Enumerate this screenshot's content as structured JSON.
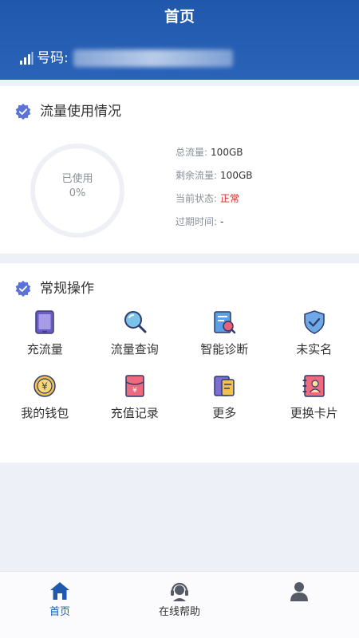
{
  "header": {
    "title": "首页",
    "phone_label": "号码:",
    "signal_icon": "signal-icon"
  },
  "usage": {
    "title": "流量使用情况",
    "ring_label": "已使用",
    "ring_percent": "0%",
    "used_fraction": 0,
    "stats": [
      {
        "key": "总流量:",
        "value": "100GB"
      },
      {
        "key": "剩余流量:",
        "value": "100GB"
      },
      {
        "key": "当前状态:",
        "value": "正常"
      },
      {
        "key": "过期时间:",
        "value": "-"
      }
    ]
  },
  "operations": {
    "title": "常规操作",
    "items": [
      {
        "label": "充流量",
        "icon": "tablet-icon"
      },
      {
        "label": "流量查询",
        "icon": "magnifier-icon"
      },
      {
        "label": "智能诊断",
        "icon": "diagnosis-icon"
      },
      {
        "label": "未实名",
        "icon": "shield-check-icon"
      },
      {
        "label": "我的钱包",
        "icon": "coin-icon"
      },
      {
        "label": "充值记录",
        "icon": "red-envelope-icon"
      },
      {
        "label": "更多",
        "icon": "document-icon"
      },
      {
        "label": "更换卡片",
        "icon": "id-card-icon"
      }
    ]
  },
  "nav": {
    "items": [
      {
        "label": "首页",
        "icon": "home-icon",
        "active": true
      },
      {
        "label": "在线帮助",
        "icon": "headset-icon",
        "active": false
      },
      {
        "label": "",
        "icon": "user-icon",
        "active": false
      }
    ]
  },
  "colors": {
    "header_blue": "#1f58ad",
    "status_red": "#d7261d",
    "background": "#eef0f7"
  }
}
